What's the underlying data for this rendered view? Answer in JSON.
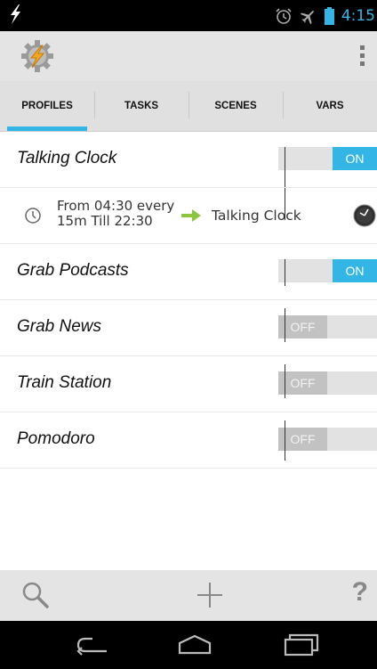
{
  "status_bar": {
    "time": "4:15",
    "icons": [
      "lightning-notification-icon",
      "alarm-icon",
      "airplane-mode-icon",
      "battery-icon"
    ]
  },
  "action_bar": {
    "app_icon": "tasker-icon",
    "overflow_icon": "overflow-menu-icon"
  },
  "tabs": [
    {
      "label": "PROFILES",
      "active": true
    },
    {
      "label": "TASKS",
      "active": false
    },
    {
      "label": "SCENES",
      "active": false
    },
    {
      "label": "VARS",
      "active": false
    }
  ],
  "profiles": [
    {
      "name": "Talking Clock",
      "toggle": "ON",
      "expanded": true,
      "context": "From 04:30 every 15m Till 22:30",
      "task": "Talking Clock"
    },
    {
      "name": "Grab Podcasts",
      "toggle": "ON"
    },
    {
      "name": "Grab News",
      "toggle": "OFF"
    },
    {
      "name": "Train Station",
      "toggle": "OFF"
    },
    {
      "name": "Pomodoro",
      "toggle": "OFF"
    }
  ],
  "bottom_bar": {
    "search_icon": "search-icon",
    "add_icon": "add-icon",
    "help_label": "?"
  },
  "nav_bar": {
    "icons": [
      "back-icon",
      "home-icon",
      "recent-apps-icon"
    ]
  },
  "colors": {
    "accent": "#33b5e5",
    "arrow_green": "#8cc63f",
    "off_knob": "#c2c2c2"
  }
}
